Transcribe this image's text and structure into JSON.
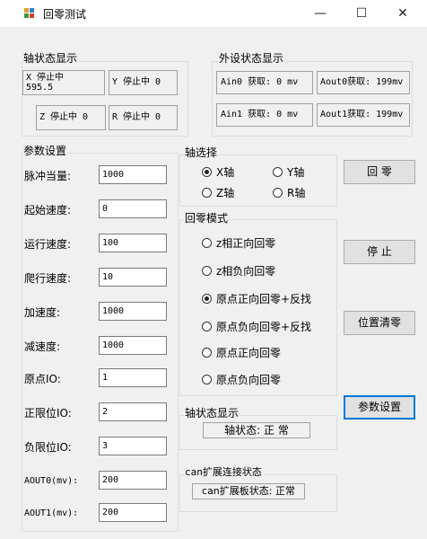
{
  "window": {
    "title": "回零测试",
    "minimize": "—",
    "maximize": "☐",
    "close": "✕"
  },
  "axis_status": {
    "legend": "轴状态显示",
    "x_line1": "X  停止中",
    "x_line2": "595.5",
    "y": "Y  停止中 0",
    "z": "Z  停止中 0",
    "r": "R  停止中 0"
  },
  "ext_status": {
    "legend": "外设状态显示",
    "ain0": "Ain0 获取: 0 mv",
    "aout0": "Aout0获取: 199mv",
    "ain1": "Ain1 获取: 0 mv",
    "aout1": "Aout1获取: 199mv"
  },
  "params": {
    "legend": "参数设置",
    "fields": [
      {
        "label": "脉冲当量:",
        "value": "1000"
      },
      {
        "label": "起始速度:",
        "value": "0"
      },
      {
        "label": "运行速度:",
        "value": "100"
      },
      {
        "label": "爬行速度:",
        "value": "10"
      },
      {
        "label": "加速度:",
        "value": "1000"
      },
      {
        "label": "减速度:",
        "value": "1000"
      },
      {
        "label": "原点IO:",
        "value": "1"
      },
      {
        "label": "正限位IO:",
        "value": "2"
      },
      {
        "label": "负限位IO:",
        "value": "3"
      },
      {
        "label": "AOUT0(mv):",
        "value": "200"
      },
      {
        "label": "AOUT1(mv):",
        "value": "200"
      }
    ]
  },
  "axis_select": {
    "legend": "轴选择",
    "options": [
      {
        "label": "X轴",
        "checked": true
      },
      {
        "label": "Y轴",
        "checked": false
      },
      {
        "label": "Z轴",
        "checked": false
      },
      {
        "label": "R轴",
        "checked": false
      }
    ]
  },
  "home_mode": {
    "legend": "回零模式",
    "options": [
      {
        "label": "z相正向回零",
        "checked": false
      },
      {
        "label": "z相负向回零",
        "checked": false
      },
      {
        "label": "原点正向回零+反找",
        "checked": true
      },
      {
        "label": "原点负向回零+反找",
        "checked": false
      },
      {
        "label": "原点正向回零",
        "checked": false
      },
      {
        "label": "原点负向回零",
        "checked": false
      }
    ]
  },
  "buttons": {
    "home": "回 零",
    "stop": "停 止",
    "clear": "位置清零",
    "params": "参数设置"
  },
  "axis_state": {
    "legend": "轴状态显示",
    "text": "轴状态: 正 常"
  },
  "can": {
    "legend": "can扩展连接状态",
    "text": "can扩展板状态: 正常"
  }
}
